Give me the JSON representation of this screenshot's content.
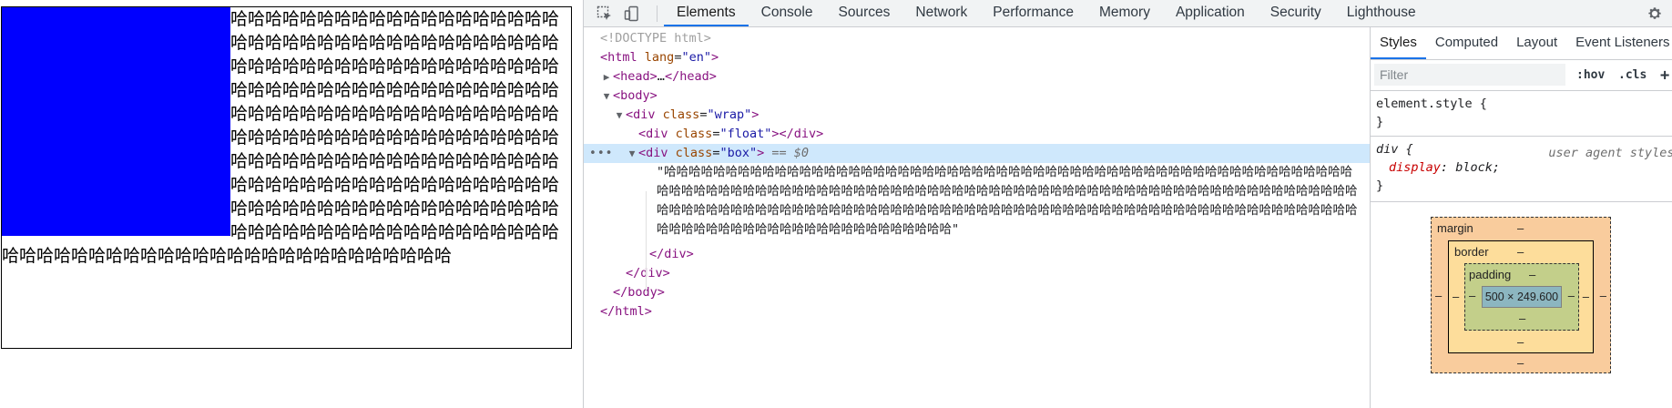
{
  "page": {
    "float_color": "#0000ff",
    "box_text": "哈哈哈哈哈哈哈哈哈哈哈哈哈哈哈哈哈哈哈哈哈哈哈哈哈哈哈哈哈哈哈哈哈哈哈哈哈哈哈哈哈哈哈哈哈哈哈哈哈哈哈哈哈哈哈哈哈哈哈哈哈哈哈哈哈哈哈哈哈哈哈哈哈哈哈哈哈哈哈哈哈哈哈哈哈哈哈哈哈哈哈哈哈哈哈哈哈哈哈哈哈哈哈哈哈哈哈哈哈哈哈哈哈哈哈哈哈哈哈哈哈哈哈哈哈哈哈哈哈哈哈哈哈哈哈哈哈哈哈哈哈哈哈哈哈哈哈哈哈哈哈哈哈哈哈哈哈哈哈哈哈哈哈哈哈哈哈哈哈哈哈哈哈哈哈哈哈哈哈哈哈哈哈哈哈哈哈哈哈哈哈哈哈哈哈哈哈哈哈哈哈哈哈哈哈哈哈哈哈哈哈哈哈哈哈哈"
  },
  "devtools": {
    "tabs": [
      "Elements",
      "Console",
      "Sources",
      "Network",
      "Performance",
      "Memory",
      "Application",
      "Security",
      "Lighthouse"
    ],
    "active_tab": "Elements",
    "dom": {
      "doctype": "<!DOCTYPE html>",
      "html_tag": "html",
      "html_attr": "lang",
      "html_attr_val": "\"en\"",
      "head_collapsed": "…",
      "head_tag": "head",
      "body_tag": "body",
      "div_tag": "div",
      "class_attr": "class",
      "wrap_val": "\"wrap\"",
      "float_val": "\"float\"",
      "box_val": "\"box\"",
      "selected_marker": "== $0",
      "text_node": "\"哈哈哈哈哈哈哈哈哈哈哈哈哈哈哈哈哈哈哈哈哈哈哈哈哈哈哈哈哈哈哈哈哈哈哈哈哈哈哈哈哈哈哈哈哈哈哈哈哈哈哈哈哈哈哈哈哈哈哈哈哈哈哈哈哈哈哈哈哈哈哈哈哈哈哈哈哈哈哈哈哈哈哈哈哈哈哈哈哈哈哈哈哈哈哈哈哈哈哈哈哈哈哈哈哈哈哈哈哈哈哈哈哈哈哈哈哈哈哈哈哈哈哈哈哈哈哈哈哈哈哈哈哈哈哈哈哈哈哈哈哈哈哈哈哈哈哈哈哈哈哈哈哈哈哈哈哈哈哈哈哈哈哈哈哈哈哈哈哈哈哈哈哈哈哈哈哈哈哈哈哈哈哈哈哈哈哈哈哈哈哈哈哈哈\""
    },
    "styles": {
      "tabs": [
        "Styles",
        "Computed",
        "Layout",
        "Event Listeners"
      ],
      "active_tab": "Styles",
      "filter_placeholder": "Filter",
      "hov": ":hov",
      "cls": ".cls",
      "plus": "+",
      "element_style": "element.style {",
      "close_brace": "}",
      "div_selector": "div {",
      "ua_source": "user agent stylesheet",
      "prop_name": "display",
      "prop_colon": ":",
      "prop_value": "block;"
    },
    "box_model": {
      "margin_label": "margin",
      "border_label": "border",
      "padding_label": "padding",
      "content_size": "500 × 249.600",
      "dash": "–"
    }
  }
}
